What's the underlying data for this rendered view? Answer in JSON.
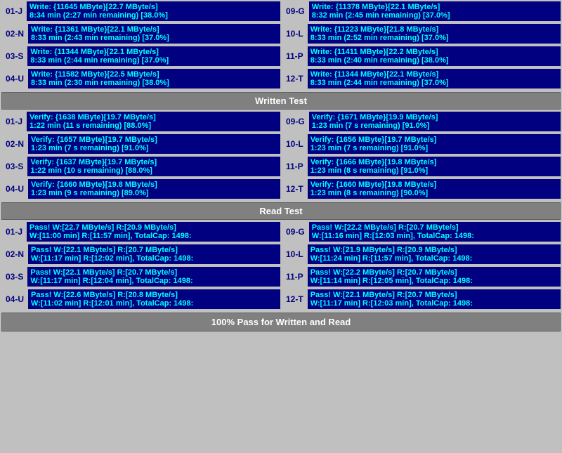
{
  "sections": {
    "written_test": {
      "label": "Written Test",
      "rows_left": [
        {
          "id": "01-J",
          "line1": "Write: {11645 MByte}[22.7 MByte/s]",
          "line2": "8:34 min (2:27 min remaining)  [38.0%]"
        },
        {
          "id": "02-N",
          "line1": "Write: {11361 MByte}[22.1 MByte/s]",
          "line2": "8:33 min (2:43 min remaining)  [37.0%]"
        },
        {
          "id": "03-S",
          "line1": "Write: {11344 MByte}[22.1 MByte/s]",
          "line2": "8:33 min (2:44 min remaining)  [37.0%]"
        },
        {
          "id": "04-U",
          "line1": "Write: {11582 MByte}[22.5 MByte/s]",
          "line2": "8:33 min (2:30 min remaining)  [38.0%]"
        }
      ],
      "rows_right": [
        {
          "id": "09-G",
          "line1": "Write: {11378 MByte}[22.1 MByte/s]",
          "line2": "8:32 min (2:45 min remaining)  [37.0%]"
        },
        {
          "id": "10-L",
          "line1": "Write: {11223 MByte}[21.8 MByte/s]",
          "line2": "8:33 min (2:52 min remaining)  [37.0%]"
        },
        {
          "id": "11-P",
          "line1": "Write: {11411 MByte}[22.2 MByte/s]",
          "line2": "8:33 min (2:40 min remaining)  [38.0%]"
        },
        {
          "id": "12-T",
          "line1": "Write: {11344 MByte}[22.1 MByte/s]",
          "line2": "8:33 min (2:44 min remaining)  [37.0%]"
        }
      ]
    },
    "verify_test": {
      "label": "Written Test",
      "rows_left": [
        {
          "id": "01-J",
          "line1": "Verify: {1638 MByte}[19.7 MByte/s]",
          "line2": "1:22 min (11 s remaining)   [88.0%]"
        },
        {
          "id": "02-N",
          "line1": "Verify: {1657 MByte}[19.7 MByte/s]",
          "line2": "1:23 min (7 s remaining)   [91.0%]"
        },
        {
          "id": "03-S",
          "line1": "Verify: {1637 MByte}[19.7 MByte/s]",
          "line2": "1:22 min (10 s remaining)   [88.0%]"
        },
        {
          "id": "04-U",
          "line1": "Verify: {1660 MByte}[19.8 MByte/s]",
          "line2": "1:23 min (9 s remaining)   [89.0%]"
        }
      ],
      "rows_right": [
        {
          "id": "09-G",
          "line1": "Verify: {1671 MByte}[19.9 MByte/s]",
          "line2": "1:23 min (7 s remaining)   [91.0%]"
        },
        {
          "id": "10-L",
          "line1": "Verify: {1656 MByte}[19.7 MByte/s]",
          "line2": "1:23 min (7 s remaining)   [91.0%]"
        },
        {
          "id": "11-P",
          "line1": "Verify: {1666 MByte}[19.8 MByte/s]",
          "line2": "1:23 min (8 s remaining)   [91.0%]"
        },
        {
          "id": "12-T",
          "line1": "Verify: {1660 MByte}[19.8 MByte/s]",
          "line2": "1:23 min (8 s remaining)   [90.0%]"
        }
      ]
    },
    "read_test": {
      "label": "Read Test",
      "rows_left": [
        {
          "id": "01-J",
          "line1": "Pass! W:[22.7 MByte/s] R:[20.9 MByte/s]",
          "line2": "W:[11:00 min] R:[11:57 min], TotalCap: 1498:"
        },
        {
          "id": "02-N",
          "line1": "Pass! W:[22.1 MByte/s] R:[20.7 MByte/s]",
          "line2": "W:[11:17 min] R:[12:02 min], TotalCap: 1498:"
        },
        {
          "id": "03-S",
          "line1": "Pass! W:[22.1 MByte/s] R:[20.7 MByte/s]",
          "line2": "W:[11:17 min] R:[12:04 min], TotalCap: 1498:"
        },
        {
          "id": "04-U",
          "line1": "Pass! W:[22.6 MByte/s] R:[20.8 MByte/s]",
          "line2": "W:[11:02 min] R:[12:01 min], TotalCap: 1498:"
        }
      ],
      "rows_right": [
        {
          "id": "09-G",
          "line1": "Pass! W:[22.2 MByte/s] R:[20.7 MByte/s]",
          "line2": "W:[11:16 min] R:[12:03 min], TotalCap: 1498:"
        },
        {
          "id": "10-L",
          "line1": "Pass! W:[21.9 MByte/s] R:[20.9 MByte/s]",
          "line2": "W:[11:24 min] R:[11:57 min], TotalCap: 1498:"
        },
        {
          "id": "11-P",
          "line1": "Pass! W:[22.2 MByte/s] R:[20.7 MByte/s]",
          "line2": "W:[11:14 min] R:[12:05 min], TotalCap: 1498:"
        },
        {
          "id": "12-T",
          "line1": "Pass! W:[22.1 MByte/s] R:[20.7 MByte/s]",
          "line2": "W:[11:17 min] R:[12:03 min], TotalCap: 1498:"
        }
      ]
    }
  },
  "headers": {
    "written": "Written Test",
    "read": "Read Test",
    "footer": "100% Pass for Written and Read"
  }
}
